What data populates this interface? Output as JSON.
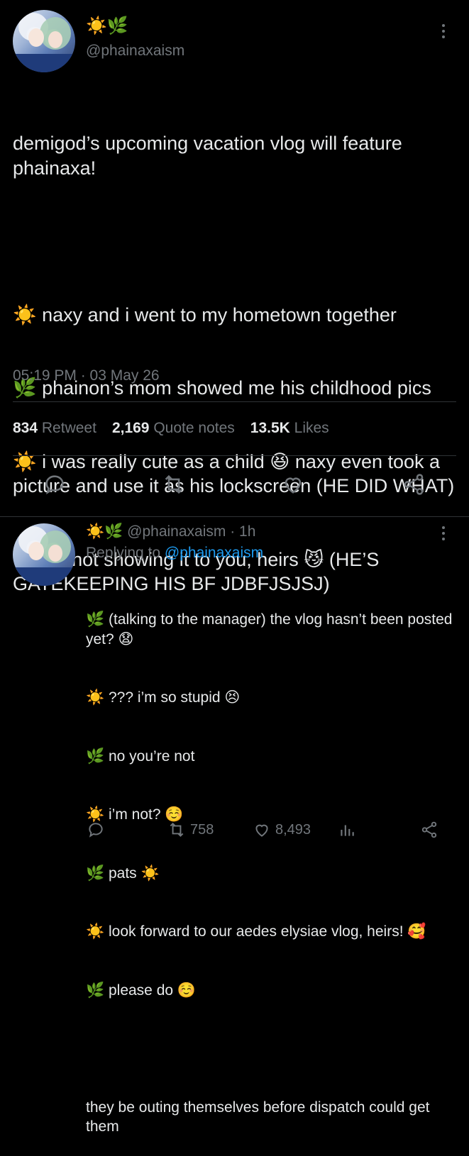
{
  "main_tweet": {
    "display_emoji": "☀️🌿",
    "handle": "@phainaxaism",
    "text_lines": [
      "demigod’s upcoming vacation vlog will feature phainaxa!",
      "",
      "☀️ naxy and i went to my hometown together",
      "🌿 phainon’s mom showed me his childhood pics",
      "☀️ i was really cute as a child 😆 naxy even took a picture and use it as his lockscreen (HE DID WHAT)",
      "🌿 i’m not showing it to you, heirs 😼 (HE’S GATEKEEPING HIS BF JDBFJSJSJ)"
    ],
    "timestamp": "05:19 PM · 03 May 26",
    "stats": {
      "retweets_value": "834",
      "retweets_label": "Retweet",
      "quotes_value": "2,169",
      "quotes_label": "Quote notes",
      "likes_value": "13.5K",
      "likes_label": "Likes"
    },
    "action_icons": [
      "reply-icon",
      "retweet-icon",
      "like-icon",
      "share-icon"
    ]
  },
  "reply_tweet": {
    "display_emoji": "☀️🌿",
    "handle": "@phainaxaism",
    "time": "· 1h",
    "replying_label": "Replying to",
    "replying_handle": "@phainaxaism",
    "text_lines": [
      "🌿 (talking to the manager) the vlog hasn’t been posted yet? 😧",
      "☀️ ??? i’m so stupid 😣",
      "🌿 no you’re not",
      "☀️ i’m not? ☺️",
      "🌿 pats ☀️",
      "☀️ look forward to our aedes elysiae vlog, heirs! 🥰",
      "🌿 please do ☺️",
      "",
      "they be outing themselves before dispatch could get them"
    ],
    "retweets": "758",
    "likes": "8,493",
    "action_icons": [
      "reply-icon",
      "retweet-icon",
      "like-icon",
      "analytics-icon",
      "share-icon"
    ]
  },
  "colors": {
    "background": "#000000",
    "text": "#e7e9ea",
    "muted": "#71767b",
    "link": "#1d9bf0",
    "divider": "#2f3336"
  }
}
